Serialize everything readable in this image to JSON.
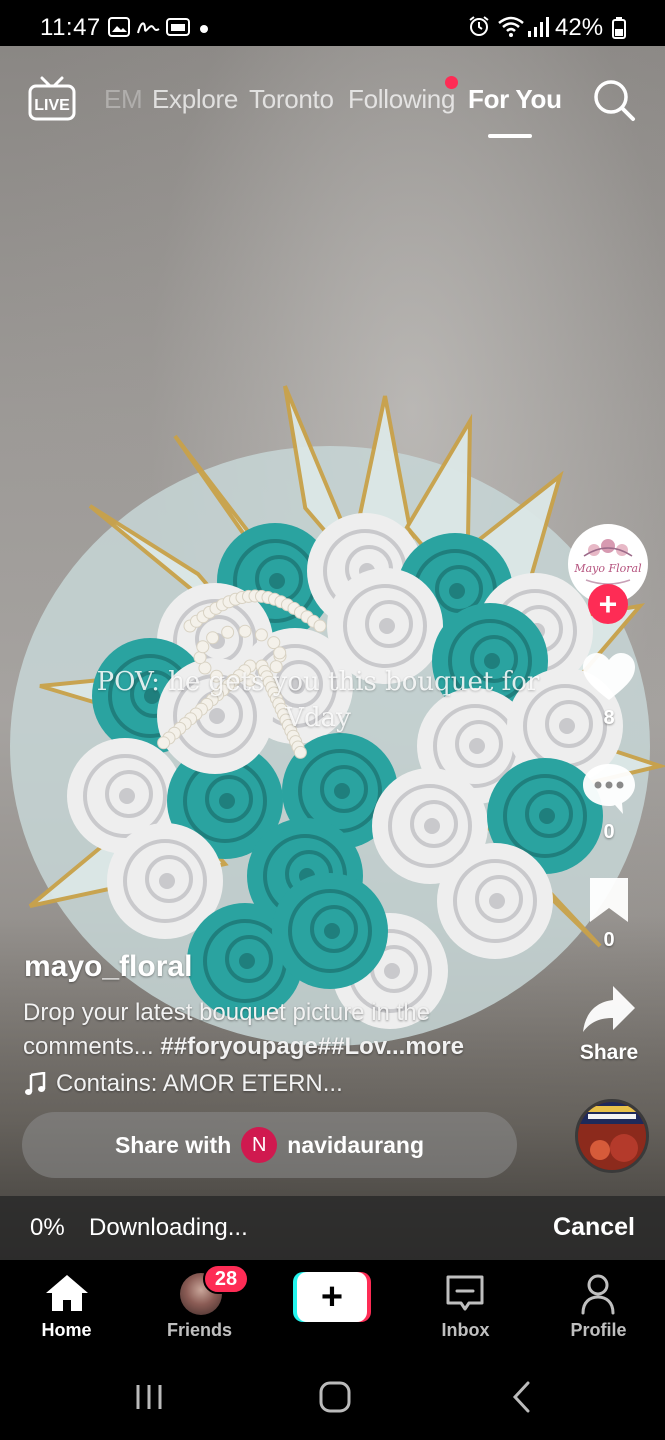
{
  "status_bar": {
    "time": "11:47",
    "battery": "42%",
    "notification_icons": [
      "gallery-icon",
      "signature-icon",
      "ai-icon",
      "dot-icon"
    ],
    "system_icons": [
      "alarm-icon",
      "wifi-icon",
      "signal-icon",
      "battery-icon"
    ]
  },
  "top_nav": {
    "tabs": [
      {
        "label": "EM",
        "state": "faded"
      },
      {
        "label": "Explore",
        "state": "inactive"
      },
      {
        "label": "Toronto",
        "state": "inactive"
      },
      {
        "label": "Following",
        "state": "inactive",
        "has_dot": true
      },
      {
        "label": "For You",
        "state": "active"
      }
    ],
    "live_icon_text": "LIVE"
  },
  "video": {
    "overlay_text": "POV: he gets you this bouquet for Vday",
    "creator_logo_text": "Mayo Floral"
  },
  "actions": {
    "likes": "8",
    "comments": "0",
    "saves": "0",
    "share_label": "Share",
    "follow_symbol": "+"
  },
  "post": {
    "username": "mayo_floral",
    "description_text": "Drop your latest bouquet picture in the comments... ",
    "hashtags": "##foryoupage##Lov",
    "more": "...more",
    "music": "Contains: AMOR ETERN..."
  },
  "share_with": {
    "prefix": "Share with",
    "avatar_letter": "N",
    "name": "navidaurang"
  },
  "download": {
    "progress": "0%",
    "status": "Downloading...",
    "cancel": "Cancel"
  },
  "bottom_nav": {
    "items": [
      {
        "label": "Home",
        "active": true
      },
      {
        "label": "Friends",
        "badge": "28"
      },
      {
        "label": "",
        "create_symbol": "+"
      },
      {
        "label": "Inbox"
      },
      {
        "label": "Profile"
      }
    ]
  },
  "colors": {
    "accent_red": "#fe2c55",
    "accent_cyan": "#25f4ee",
    "rose_teal": "#2aa3a0",
    "rose_white": "#eeeeee",
    "paper_gold": "#c9a24a"
  }
}
